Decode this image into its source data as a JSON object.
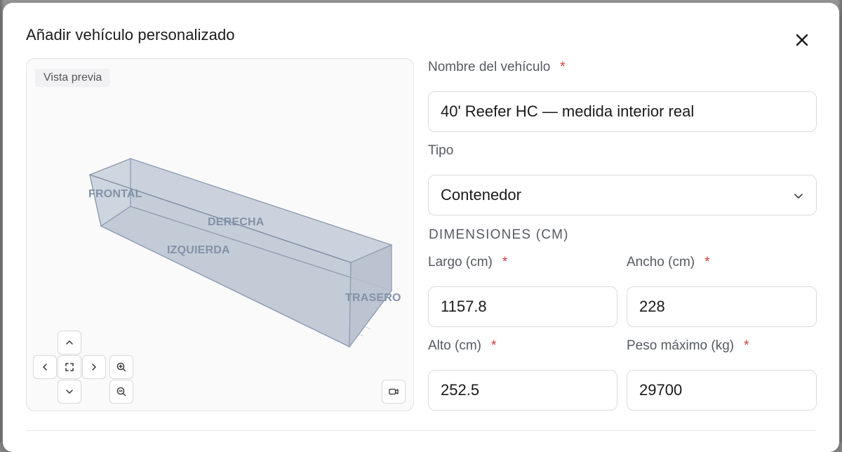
{
  "modal": {
    "title": "Añadir vehículo personalizado"
  },
  "preview": {
    "label": "Vista previa",
    "faces": {
      "front": "FRONTAL",
      "right": "DERECHA",
      "left": "IZQUIERDA",
      "rear": "TRASERO"
    },
    "controls": [
      "chevron-up-icon",
      "chevron-left-icon",
      "fit-view-icon",
      "chevron-right-icon",
      "chevron-down-icon",
      "zoom-in-icon",
      "zoom-out-icon",
      "camera-icon"
    ]
  },
  "form": {
    "name": {
      "label": "Nombre del vehículo",
      "required_mark": "*",
      "value": "40' Reefer HC — medida interior real"
    },
    "type": {
      "label": "Tipo",
      "value": "Contenedor"
    },
    "dimensions_title": "DIMENSIONES (CM)",
    "length": {
      "label": "Largo (cm)",
      "required_mark": "*",
      "value": "1157.8"
    },
    "width": {
      "label": "Ancho (cm)",
      "required_mark": "*",
      "value": "228"
    },
    "height": {
      "label": "Alto (cm)",
      "required_mark": "*",
      "value": "252.5"
    },
    "max_weight": {
      "label": "Peso máximo (kg)",
      "required_mark": "*",
      "value": "29700"
    }
  },
  "colors": {
    "required": "#d9363e",
    "box_fill": "#c7ced9",
    "box_edge": "#8e9bb0"
  }
}
